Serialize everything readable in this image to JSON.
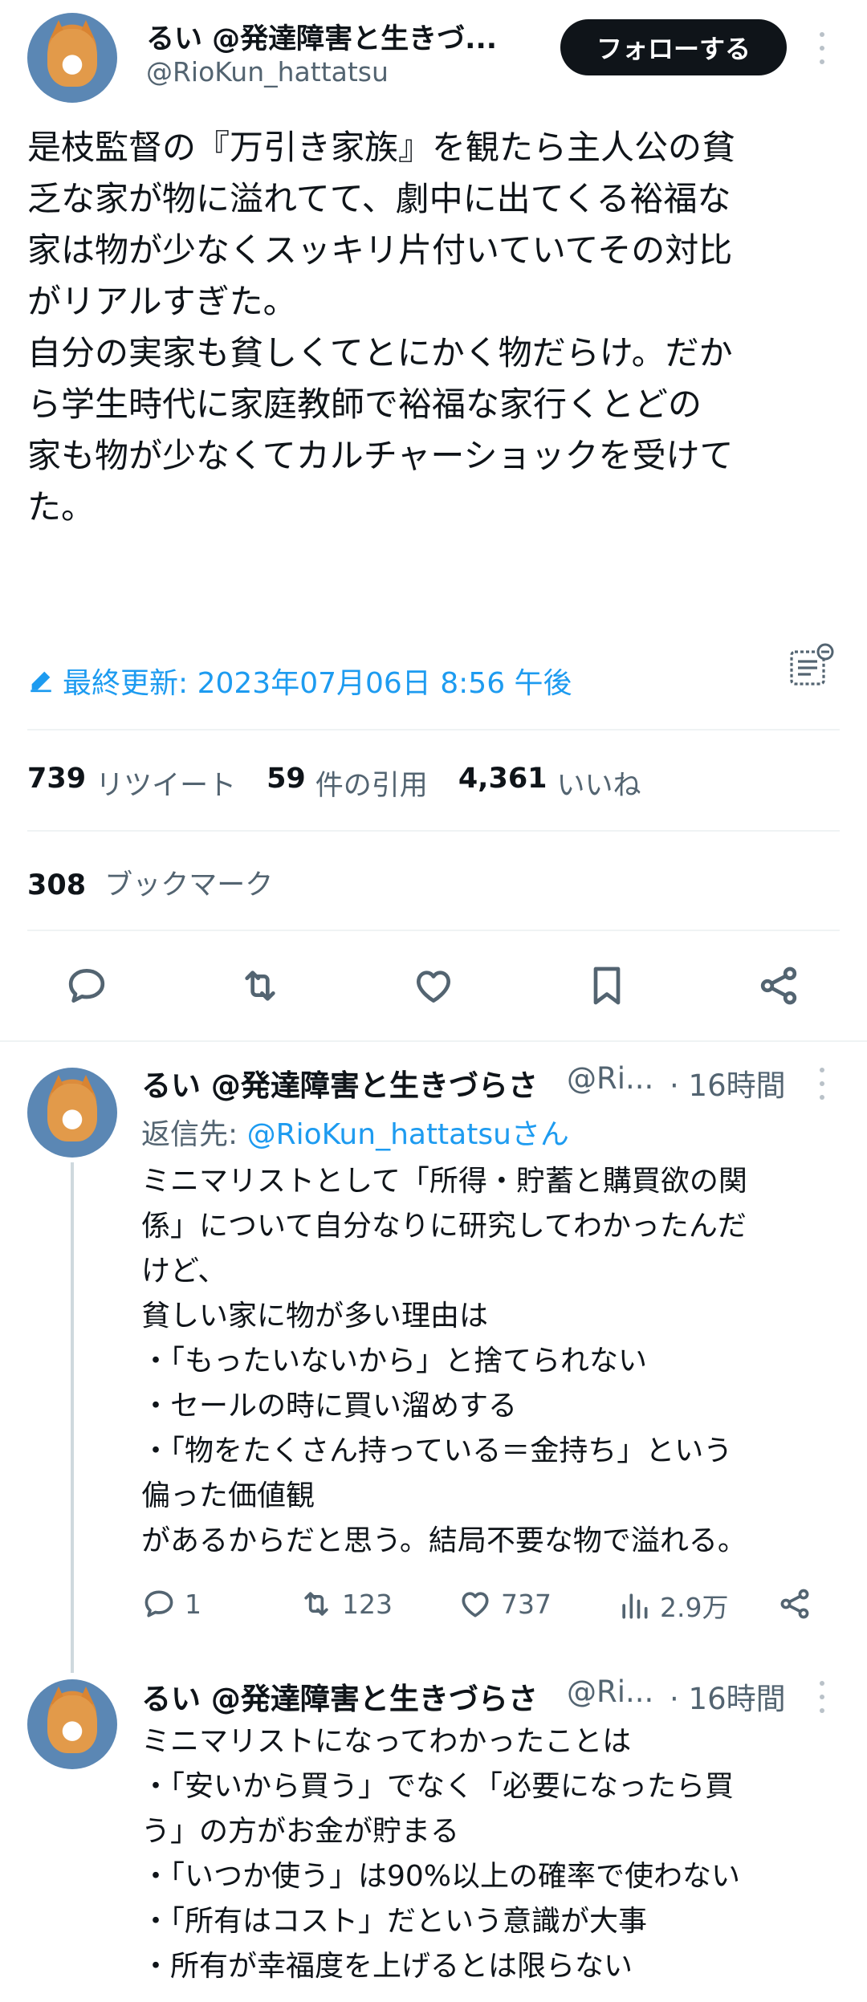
{
  "main_tweet": {
    "display_name": "るい @発達障害と生きづ...",
    "handle": "@RioKun_hattatsu",
    "follow_label": "フォローする",
    "body": "是枝監督の『万引き家族』を観たら主人公の貧\n乏な家が物に溢れてて、劇中に出てくる裕福な\n家は物が少なくスッキリ片付いていてその対比\nがリアルすぎた。\n自分の実家も貧しくてとにかく物だらけ。だか\nら学生時代に家庭教師で裕福な家行くとどの\n家も物が少なくてカルチャーショックを受けて\nた。",
    "edited_label": "最終更新: 2023年07月06日 8:56 午後",
    "retweets": "739",
    "retweets_label": "リツイート",
    "quotes": "59",
    "quotes_label": "件の引用",
    "likes": "4,361",
    "likes_label": "いいね",
    "bookmarks": "308",
    "bookmarks_label": "ブックマーク"
  },
  "replies": [
    {
      "display_name": "るい @発達障害と生きづらさ",
      "handle": "@Ri...",
      "time": "· 16時間",
      "reply_to_prefix": "返信先: ",
      "reply_to_handle": "@RioKun_hattatsu",
      "reply_to_suffix": "さん",
      "body": "ミニマリストとして「所得・貯蓄と購買欲の関\n係」について自分なりに研究してわかったんだ\nけど、\n貧しい家に物が多い理由は\n・「もったいないから」と捨てられない\n・セールの時に買い溜めする\n・「物をたくさん持っている＝金持ち」という\n偏った価値観\nがあるからだと思う。結局不要な物で溢れる。",
      "replies": "1",
      "retweets": "123",
      "likes": "737",
      "views": "2.9万"
    },
    {
      "display_name": "るい @発達障害と生きづらさ",
      "handle": "@Ri...",
      "time": "· 16時間",
      "body": "ミニマリストになってわかったことは\n・「安いから買う」でなく「必要になったら買\nう」の方がお金が貯まる\n・「いつか使う」は90%以上の確率で使わない\n・「所有はコスト」だという意識が大事\n・所有が幸福度を上げるとは限らない"
    }
  ],
  "colors": {
    "text": "#0f1419",
    "secondary": "#536471",
    "link": "#1d9bf0",
    "divider": "#eff3f4"
  },
  "icons": [
    "edit-pencil-icon",
    "notes-icon",
    "reply-icon",
    "retweet-icon",
    "like-icon",
    "bookmark-icon",
    "share-icon",
    "views-icon",
    "more-icon"
  ]
}
